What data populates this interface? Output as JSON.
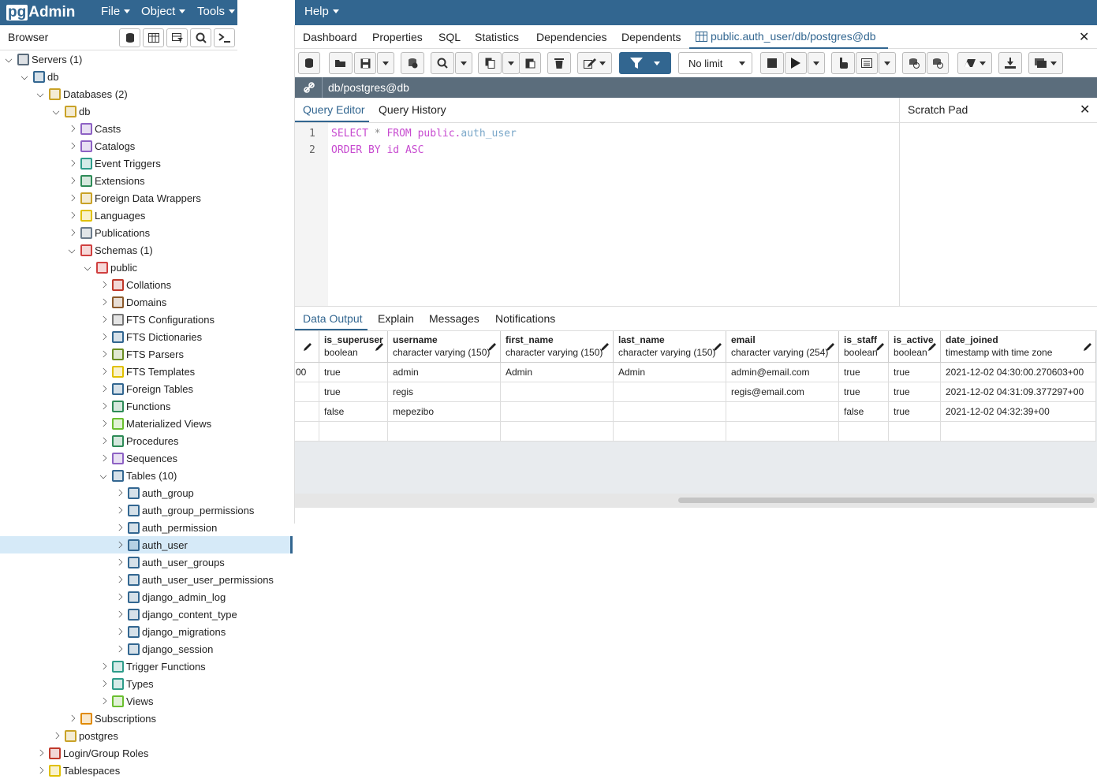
{
  "app": {
    "logo_pg": "pg",
    "logo_admin": "Admin",
    "menus": [
      "File",
      "Object",
      "Tools",
      "Help"
    ]
  },
  "browser": {
    "title": "Browser",
    "tree": [
      {
        "label": "Servers (1)",
        "icon": "servers-icon",
        "color": "#5a6b7b",
        "level": 0,
        "expanded": true
      },
      {
        "label": "db",
        "icon": "postgres-server-icon",
        "color": "#336791",
        "level": 1,
        "expanded": true
      },
      {
        "label": "Databases (2)",
        "icon": "databases-icon",
        "color": "#c9a227",
        "level": 2,
        "expanded": true
      },
      {
        "label": "db",
        "icon": "database-icon",
        "color": "#c9a227",
        "level": 3,
        "expanded": true
      },
      {
        "label": "Casts",
        "icon": "casts-icon",
        "color": "#8e62c4",
        "level": 4,
        "expanded": false
      },
      {
        "label": "Catalogs",
        "icon": "catalogs-icon",
        "color": "#8e62c4",
        "level": 4,
        "expanded": false
      },
      {
        "label": "Event Triggers",
        "icon": "event-triggers-icon",
        "color": "#2e9c8a",
        "level": 4,
        "expanded": false
      },
      {
        "label": "Extensions",
        "icon": "extensions-icon",
        "color": "#2e8b57",
        "level": 4,
        "expanded": false
      },
      {
        "label": "Foreign Data Wrappers",
        "icon": "fdw-icon",
        "color": "#c9a227",
        "level": 4,
        "expanded": false
      },
      {
        "label": "Languages",
        "icon": "languages-icon",
        "color": "#e0c000",
        "level": 4,
        "expanded": false
      },
      {
        "label": "Publications",
        "icon": "publications-icon",
        "color": "#6b7b8b",
        "level": 4,
        "expanded": false
      },
      {
        "label": "Schemas (1)",
        "icon": "schemas-icon",
        "color": "#d04040",
        "level": 4,
        "expanded": true
      },
      {
        "label": "public",
        "icon": "schema-icon",
        "color": "#d04040",
        "level": 5,
        "expanded": true
      },
      {
        "label": "Collations",
        "icon": "collations-icon",
        "color": "#c0392b",
        "level": 6,
        "expanded": false
      },
      {
        "label": "Domains",
        "icon": "domains-icon",
        "color": "#8b5a2b",
        "level": 6,
        "expanded": false
      },
      {
        "label": "FTS Configurations",
        "icon": "fts-configurations-icon",
        "color": "#777777",
        "level": 6,
        "expanded": false
      },
      {
        "label": "FTS Dictionaries",
        "icon": "fts-dictionaries-icon",
        "color": "#336791",
        "level": 6,
        "expanded": false
      },
      {
        "label": "FTS Parsers",
        "icon": "fts-parsers-icon",
        "color": "#6b8e23",
        "level": 6,
        "expanded": false
      },
      {
        "label": "FTS Templates",
        "icon": "fts-templates-icon",
        "color": "#e0c000",
        "level": 6,
        "expanded": false
      },
      {
        "label": "Foreign Tables",
        "icon": "foreign-tables-icon",
        "color": "#336791",
        "level": 6,
        "expanded": false
      },
      {
        "label": "Functions",
        "icon": "functions-icon",
        "color": "#2e8b57",
        "level": 6,
        "expanded": false
      },
      {
        "label": "Materialized Views",
        "icon": "materialized-views-icon",
        "color": "#6bbf30",
        "level": 6,
        "expanded": false
      },
      {
        "label": "Procedures",
        "icon": "procedures-icon",
        "color": "#2e8b57",
        "level": 6,
        "expanded": false
      },
      {
        "label": "Sequences",
        "icon": "sequences-icon",
        "color": "#8e62c4",
        "level": 6,
        "expanded": false
      },
      {
        "label": "Tables (10)",
        "icon": "tables-icon",
        "color": "#336791",
        "level": 6,
        "expanded": true
      },
      {
        "label": "auth_group",
        "icon": "table-icon",
        "color": "#336791",
        "level": 7,
        "expanded": false
      },
      {
        "label": "auth_group_permissions",
        "icon": "table-icon",
        "color": "#336791",
        "level": 7,
        "expanded": false
      },
      {
        "label": "auth_permission",
        "icon": "table-icon",
        "color": "#336791",
        "level": 7,
        "expanded": false
      },
      {
        "label": "auth_user",
        "icon": "table-icon",
        "color": "#336791",
        "level": 7,
        "expanded": false,
        "selected": true
      },
      {
        "label": "auth_user_groups",
        "icon": "table-icon",
        "color": "#336791",
        "level": 7,
        "expanded": false
      },
      {
        "label": "auth_user_user_permissions",
        "icon": "table-icon",
        "color": "#336791",
        "level": 7,
        "expanded": false
      },
      {
        "label": "django_admin_log",
        "icon": "table-icon",
        "color": "#336791",
        "level": 7,
        "expanded": false
      },
      {
        "label": "django_content_type",
        "icon": "table-icon",
        "color": "#336791",
        "level": 7,
        "expanded": false
      },
      {
        "label": "django_migrations",
        "icon": "table-icon",
        "color": "#336791",
        "level": 7,
        "expanded": false
      },
      {
        "label": "django_session",
        "icon": "table-icon",
        "color": "#336791",
        "level": 7,
        "expanded": false
      },
      {
        "label": "Trigger Functions",
        "icon": "trigger-functions-icon",
        "color": "#2e9c8a",
        "level": 6,
        "expanded": false
      },
      {
        "label": "Types",
        "icon": "types-icon",
        "color": "#2e9c8a",
        "level": 6,
        "expanded": false
      },
      {
        "label": "Views",
        "icon": "views-icon",
        "color": "#6bbf30",
        "level": 6,
        "expanded": false
      },
      {
        "label": "Subscriptions",
        "icon": "subscriptions-icon",
        "color": "#e08a00",
        "level": 4,
        "expanded": false
      },
      {
        "label": "postgres",
        "icon": "database-icon",
        "color": "#c9a227",
        "level": 3,
        "expanded": false
      },
      {
        "label": "Login/Group Roles",
        "icon": "roles-icon",
        "color": "#c0392b",
        "level": 2,
        "expanded": false
      },
      {
        "label": "Tablespaces",
        "icon": "tablespaces-icon",
        "color": "#e0c000",
        "level": 2,
        "expanded": false
      }
    ]
  },
  "main_tabs": [
    "Dashboard",
    "Properties",
    "SQL",
    "Statistics",
    "Dependencies",
    "Dependents",
    "public.auth_user/db/postgres@db"
  ],
  "toolbar": {
    "limit_value": "No limit"
  },
  "connection": "db/postgres@db",
  "editor_tabs": [
    "Query Editor",
    "Query History"
  ],
  "scratch_pad": "Scratch Pad",
  "query": {
    "line_numbers": [
      "1",
      "2"
    ],
    "line1": {
      "kw1": "SELECT",
      "star": " * ",
      "kw2": "FROM",
      "schema": " public.",
      "table": "auth_user"
    },
    "line2": {
      "kw1": "ORDER BY",
      "col": " id ",
      "kw2": "ASC"
    }
  },
  "output_tabs": [
    "Data Output",
    "Explain",
    "Messages",
    "Notifications"
  ],
  "grid": {
    "columns": [
      {
        "name": "is_superuser",
        "type": "boolean"
      },
      {
        "name": "username",
        "type": "character varying (150)"
      },
      {
        "name": "first_name",
        "type": "character varying (150)"
      },
      {
        "name": "last_name",
        "type": "character varying (150)"
      },
      {
        "name": "email",
        "type": "character varying (254)"
      },
      {
        "name": "is_staff",
        "type": "boolean"
      },
      {
        "name": "is_active",
        "type": "boolean"
      },
      {
        "name": "date_joined",
        "type": "timestamp with time zone"
      }
    ],
    "rows": [
      {
        "prefix": "00",
        "cells": [
          "true",
          "admin",
          "Admin",
          "Admin",
          "admin@email.com",
          "true",
          "true",
          "2021-12-02 04:30:00.270603+00"
        ]
      },
      {
        "prefix": "",
        "cells": [
          "true",
          "regis",
          "",
          "",
          "regis@email.com",
          "true",
          "true",
          "2021-12-02 04:31:09.377297+00"
        ]
      },
      {
        "prefix": "",
        "cells": [
          "false",
          "mepezibo",
          "",
          "",
          "",
          "false",
          "true",
          "2021-12-02 04:32:39+00"
        ]
      },
      {
        "prefix": "",
        "cells": [
          "",
          "",
          "",
          "",
          "",
          "",
          "",
          ""
        ]
      }
    ]
  }
}
